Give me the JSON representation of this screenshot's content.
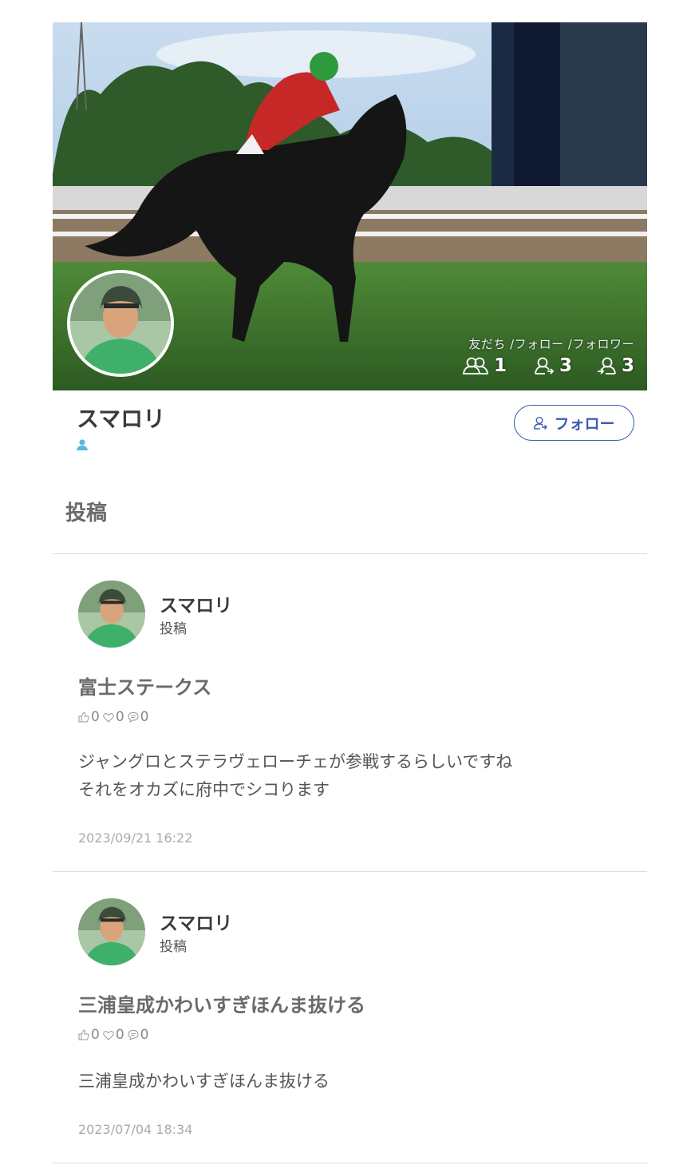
{
  "profile": {
    "name": "スマロリ",
    "stats_label": "友だち /フォロー /フォロワー",
    "friends_count": "1",
    "following_count": "3",
    "followers_count": "3",
    "follow_button_label": "フォロー"
  },
  "section": {
    "title": "投稿"
  },
  "posts": [
    {
      "user": "スマロリ",
      "type": "投稿",
      "title": "富士ステークス",
      "likes": "0",
      "hearts": "0",
      "comments": "0",
      "body": "ジャングロとステラヴェローチェが参戦するらしいですね\nそれをオカズに府中でシコります",
      "date": "2023/09/21 16:22"
    },
    {
      "user": "スマロリ",
      "type": "投稿",
      "title": "三浦皇成かわいすぎほんま抜ける",
      "likes": "0",
      "hearts": "0",
      "comments": "0",
      "body": "三浦皇成かわいすぎほんま抜ける",
      "date": "2023/07/04 18:34"
    }
  ],
  "colors": {
    "accent": "#3b5bb4",
    "badge": "#5bb8e0",
    "divider": "#dcdcdc"
  }
}
